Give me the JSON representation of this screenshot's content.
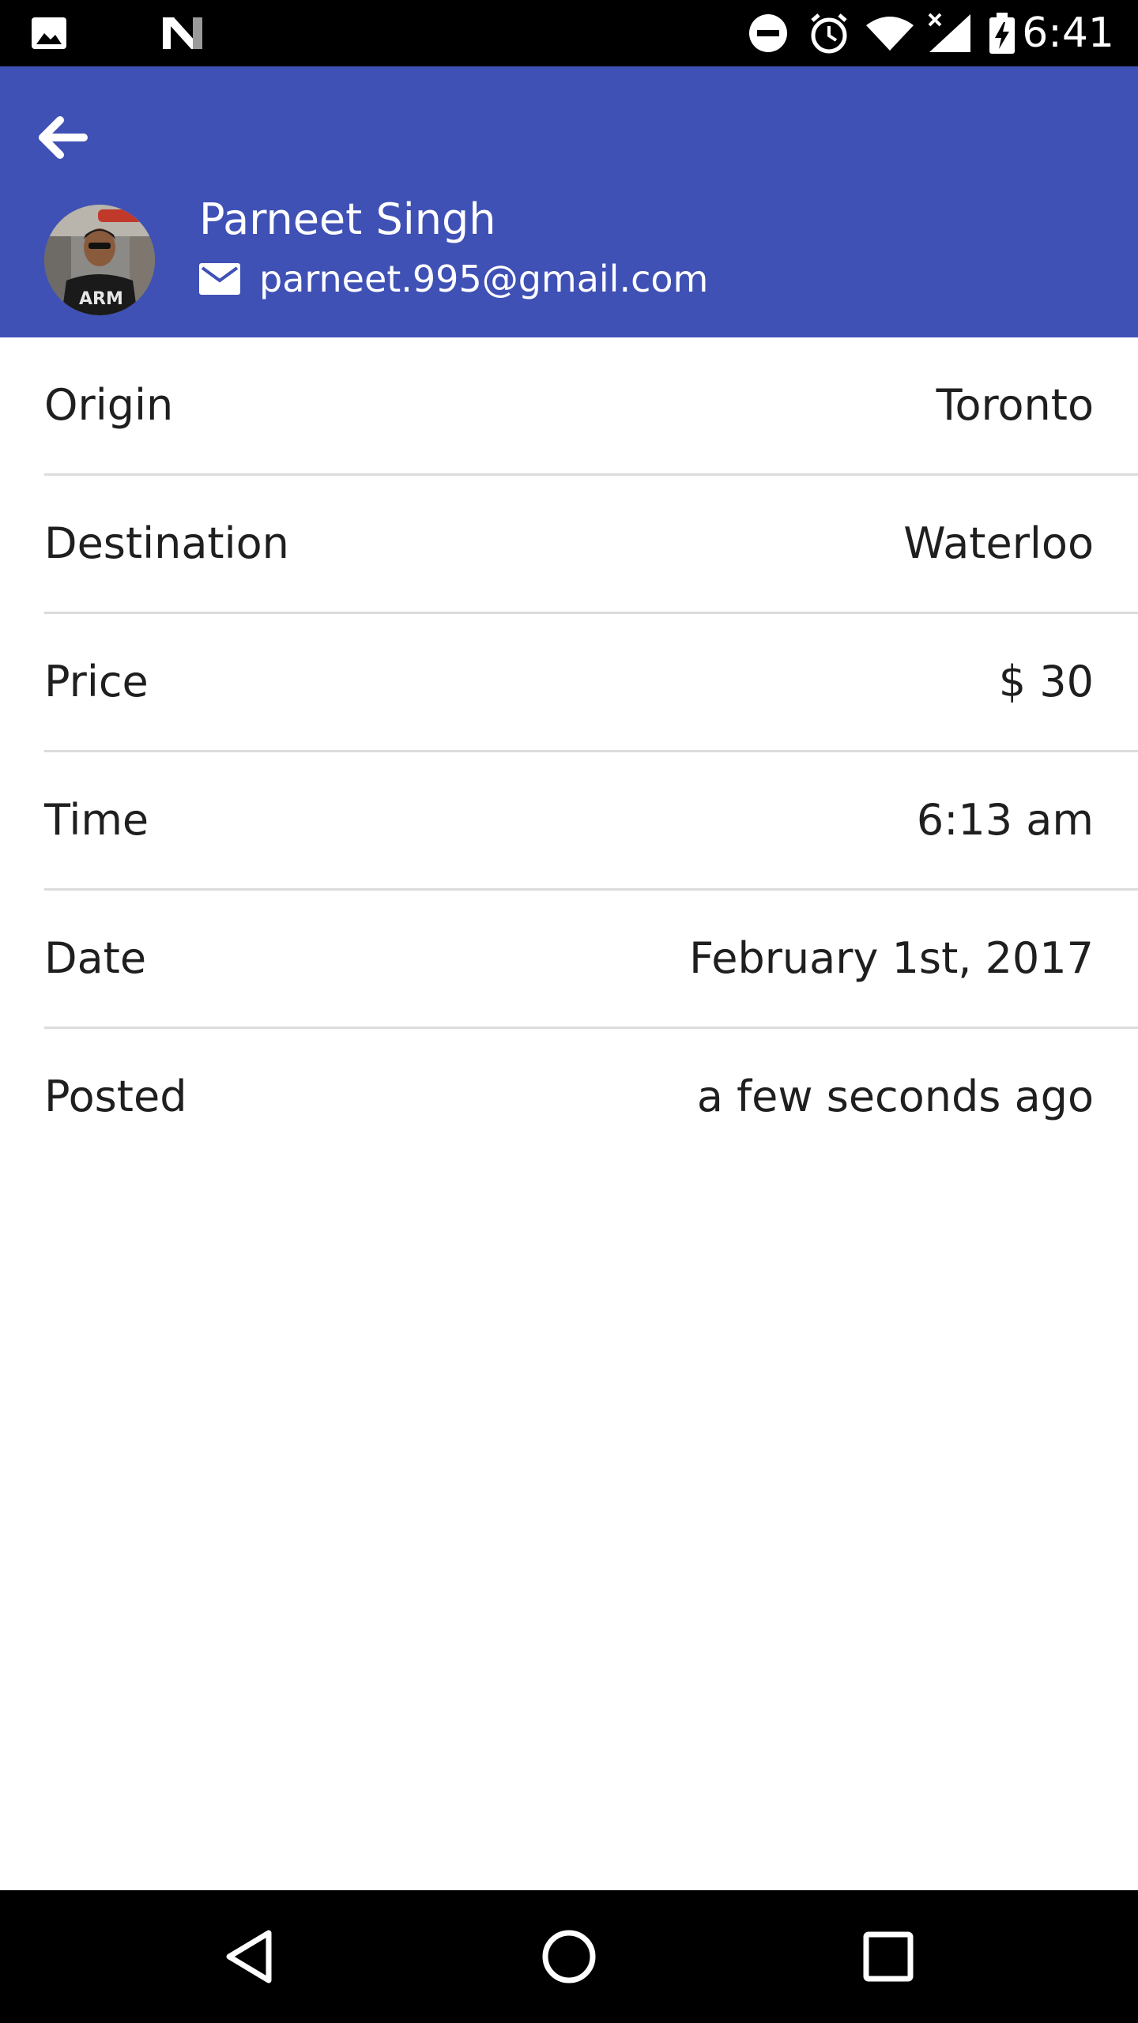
{
  "status_bar": {
    "time": "6:41",
    "icons": [
      "image-notification-icon",
      "n-logo-icon",
      "do-not-disturb-icon",
      "alarm-icon",
      "wifi-icon",
      "cellular-no-signal-icon",
      "battery-charging-icon"
    ]
  },
  "header": {
    "background": "#3f51b5",
    "user_name": "Parneet Singh",
    "email": "parneet.995@gmail.com",
    "icons": [
      "back-arrow-icon",
      "mail-icon"
    ]
  },
  "details": [
    {
      "label": "Origin",
      "value": "Toronto"
    },
    {
      "label": "Destination",
      "value": "Waterloo"
    },
    {
      "label": "Price",
      "value": "$ 30"
    },
    {
      "label": "Time",
      "value": "6:13 am"
    },
    {
      "label": "Date",
      "value": "February 1st, 2017"
    },
    {
      "label": "Posted",
      "value": "a few seconds ago"
    }
  ],
  "nav_bar": {
    "icons": [
      "nav-back-icon",
      "nav-home-icon",
      "nav-recents-icon"
    ]
  }
}
